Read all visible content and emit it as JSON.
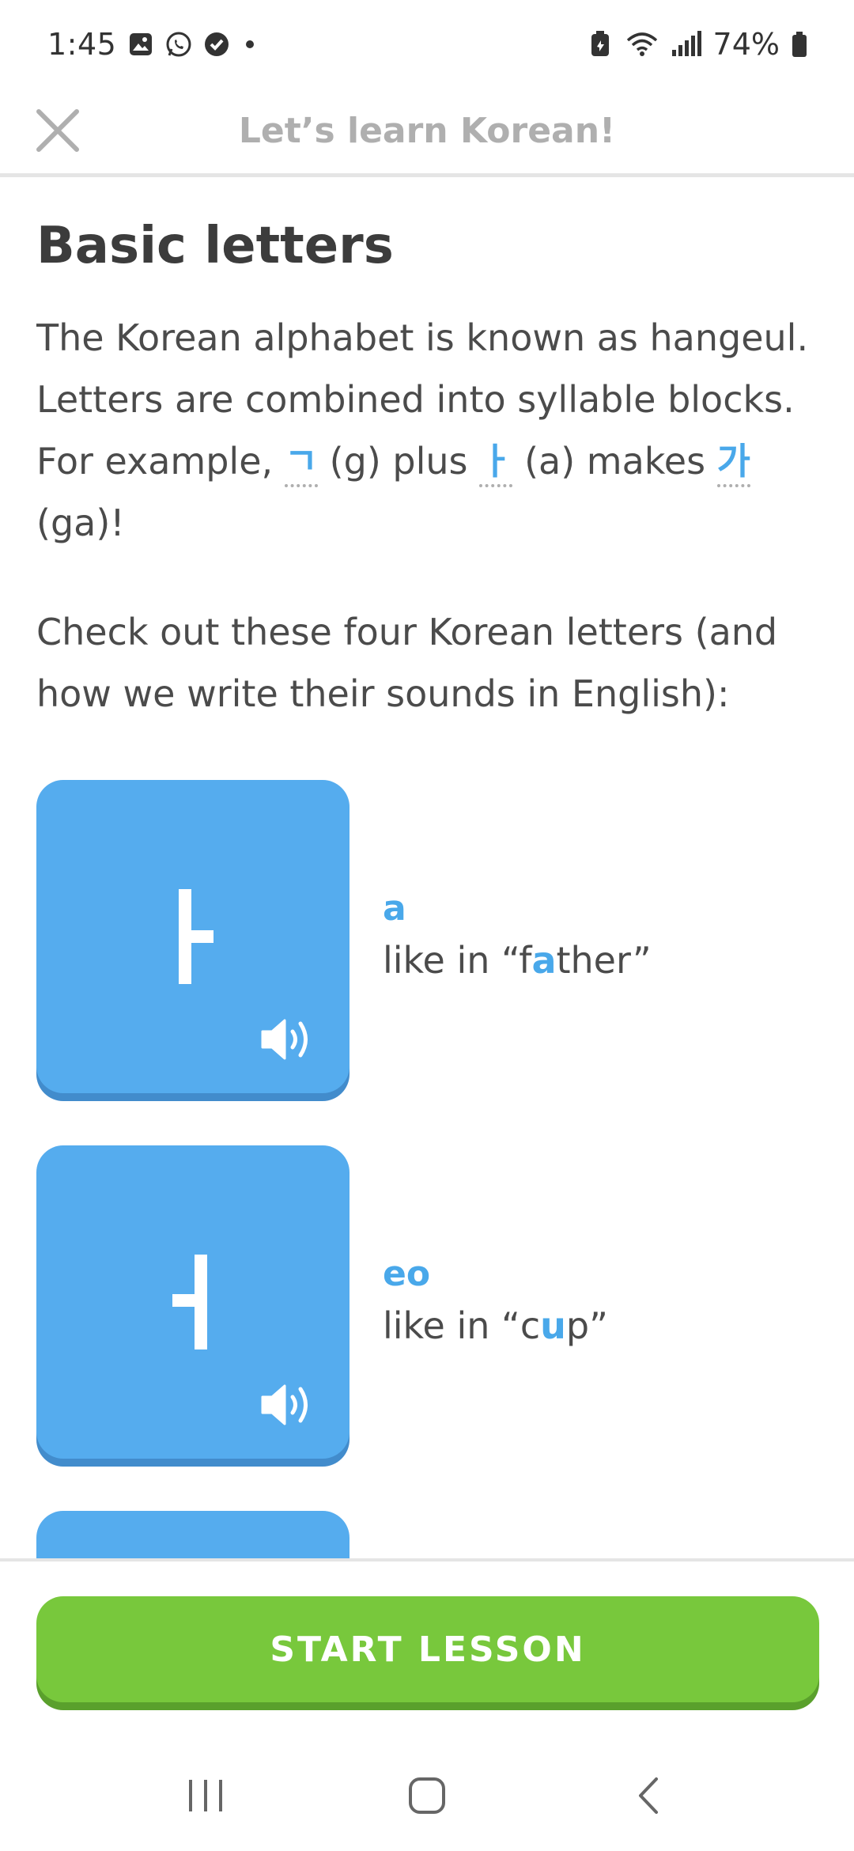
{
  "status": {
    "time": "1:45",
    "battery": "74%"
  },
  "header": {
    "title": "Let’s learn Korean!"
  },
  "content": {
    "title": "Basic letters",
    "para1": {
      "s1": "The Korean alphabet is known as hangeul. Letters are combined into syllable blocks. For example, ",
      "h1": "ㄱ",
      "s2": " (g) plus ",
      "h2": "ㅏ",
      "s3": " (a) makes ",
      "h3": "가",
      "s4": " (ga)!"
    },
    "para2": "Check out these four Korean letters (and how we write their sounds in English):",
    "letters": [
      {
        "romanization": "a",
        "example_prefix": "like in “f",
        "example_highlight": "a",
        "example_suffix": "ther”"
      },
      {
        "romanization": "eo",
        "example_prefix": "like in “c",
        "example_highlight": "u",
        "example_suffix": "p”"
      }
    ]
  },
  "footer": {
    "start_label": "START LESSON"
  },
  "colors": {
    "card_blue": "#55acee",
    "accent_blue": "#49a8ea",
    "button_green": "#78c83c"
  },
  "icons": {
    "close": "close-icon",
    "speaker": "speaker-icon",
    "nav_recent": "recent-apps-icon",
    "nav_home": "home-icon",
    "nav_back": "back-icon"
  }
}
